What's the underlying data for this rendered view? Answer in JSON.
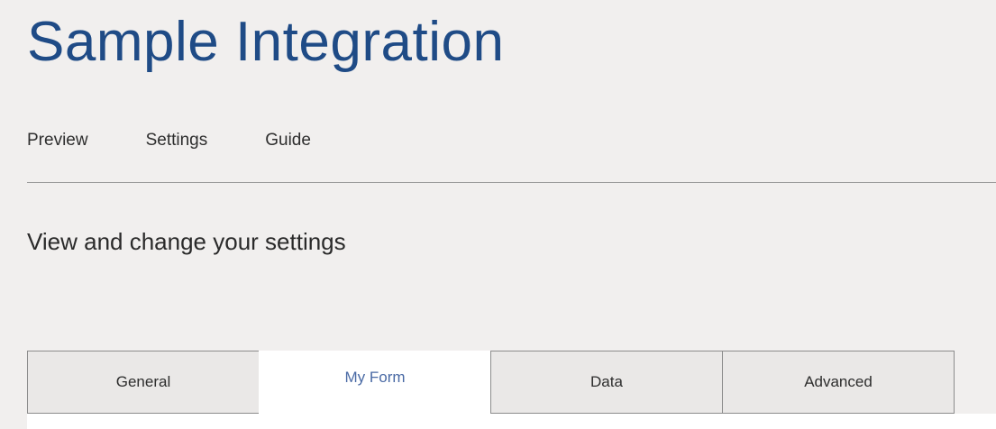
{
  "header": {
    "title": "Sample Integration"
  },
  "nav": {
    "items": [
      {
        "label": "Preview"
      },
      {
        "label": "Settings"
      },
      {
        "label": "Guide"
      }
    ]
  },
  "main": {
    "subtitle": "View and change your settings",
    "tabs": [
      {
        "label": "General",
        "active": false
      },
      {
        "label": "My Form",
        "active": true
      },
      {
        "label": "Data",
        "active": false
      },
      {
        "label": "Advanced",
        "active": false
      }
    ]
  },
  "colors": {
    "background": "#f1efee",
    "title": "#1f4b86",
    "active_tab_text": "#4a6aa5"
  }
}
